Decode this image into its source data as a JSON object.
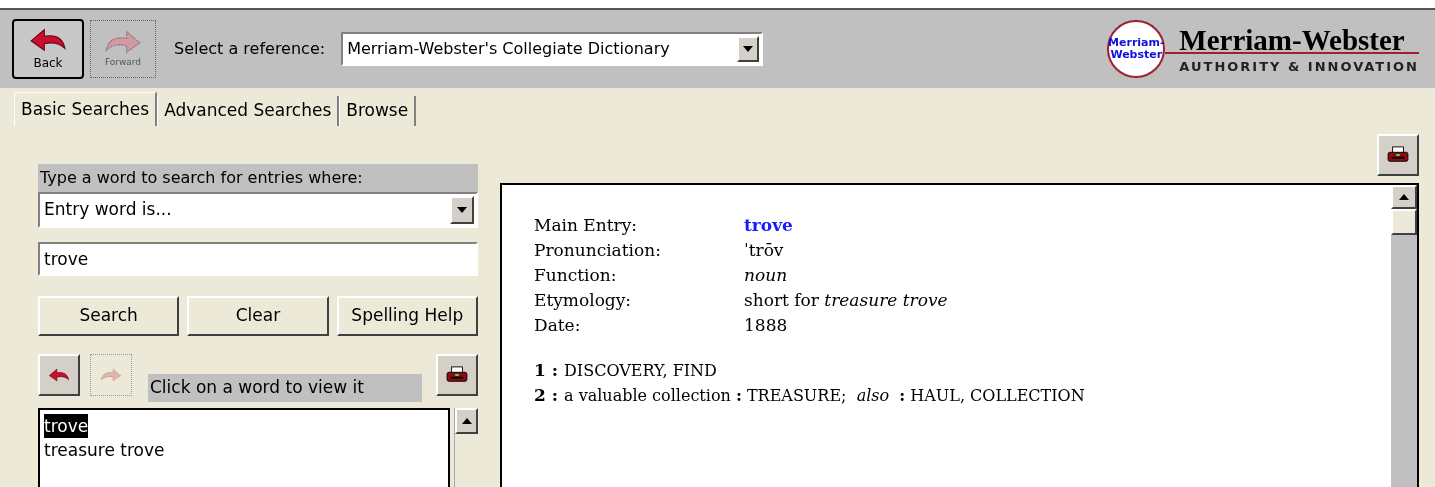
{
  "toolbar": {
    "back": {
      "label": "Back",
      "disabled": false
    },
    "forward": {
      "label": "Forward",
      "disabled": true
    },
    "reference_label": "Select a reference:",
    "reference": "Merriam-Webster's Collegiate Dictionary"
  },
  "logo": {
    "badge_top": "Merriam-",
    "badge_bottom": "Webster",
    "name": "Merriam-Webster",
    "tagline": "AUTHORITY & INNOVATION"
  },
  "tabs": [
    {
      "label": "Basic Searches",
      "selected": true
    },
    {
      "label": "Advanced Searches",
      "selected": false
    },
    {
      "label": "Browse",
      "selected": false
    }
  ],
  "search": {
    "prompt": "Type a word to search for entries where:",
    "mode": "Entry word is...",
    "value": "trove",
    "buttons": [
      "Search",
      "Clear",
      "Spelling Help"
    ]
  },
  "history": {
    "back_disabled": false,
    "forward_disabled": true,
    "hint": "Click on a word to view it"
  },
  "results": [
    {
      "label": "trove",
      "selected": true
    },
    {
      "label": "treasure trove",
      "selected": false
    }
  ],
  "entry": {
    "fields": [
      {
        "label": "Main Entry:",
        "value": "trove",
        "kind": "headword"
      },
      {
        "label": "Pronunciation:",
        "value": "ˈtrōv",
        "kind": "plain"
      },
      {
        "label": "Function:",
        "value": "noun",
        "kind": "italic"
      },
      {
        "label": "Etymology:",
        "value": "short for *treasure trove*",
        "kind": "plain"
      },
      {
        "label": "Date:",
        "value": "1888",
        "kind": "plain"
      }
    ],
    "senses": [
      {
        "number": "1 :",
        "text": "DISCOVERY, FIND"
      },
      {
        "number": "2 :",
        "text": "a valuable collection **:** TREASURE;  *also*  **:** HAUL, COLLECTION"
      }
    ]
  }
}
